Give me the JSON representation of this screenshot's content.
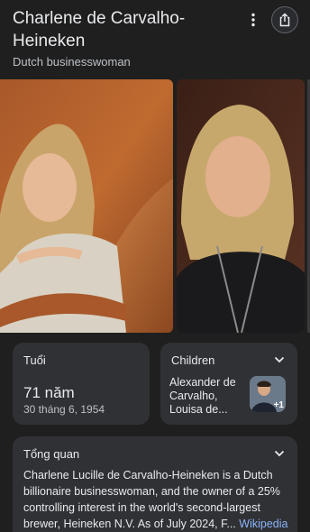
{
  "header": {
    "title": "Charlene de Carvalho-Heineken",
    "subtitle": "Dutch businesswoman",
    "more_icon": "more-vert-icon",
    "share_icon": "share-icon"
  },
  "cards": {
    "age": {
      "label": "Tuổi",
      "value": "71 năm",
      "date": "30 tháng 6, 1954"
    },
    "children": {
      "label": "Children",
      "names": "Alexander de Carvalho, Louisa de...",
      "more_count": "+1"
    },
    "overview": {
      "label": "Tổng quan",
      "text": "Charlene Lucille de Carvalho-Heineken is a Dutch billionaire businesswoman, and the owner of a 25% controlling interest in the world's second-largest brewer, Heineken N.V. As of July 2024, F...",
      "source": "Wikipedia"
    }
  },
  "colors": {
    "background": "#1f1f1f",
    "card": "#303134",
    "link": "#8ab4f8"
  }
}
